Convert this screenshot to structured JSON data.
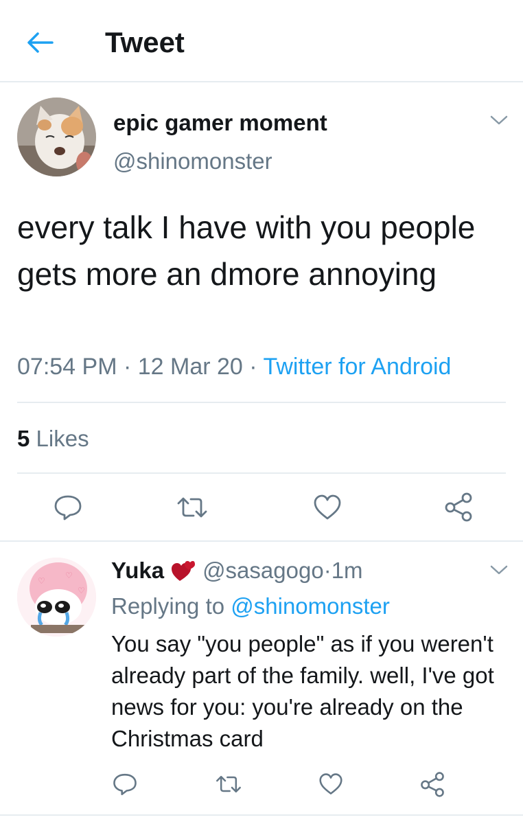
{
  "header": {
    "title": "Tweet"
  },
  "tweet": {
    "display_name": "epic gamer moment",
    "handle": "@shinomonster",
    "text": "every talk I have with you people gets more an dmore annoying",
    "time": "07:54 PM",
    "date": "12 Mar 20",
    "source": "Twitter for Android",
    "separator": " · ",
    "likes_count": "5",
    "likes_label": "Likes"
  },
  "reply": {
    "display_name": "Yuka",
    "emoji": "💕",
    "handle": "@sasagogo",
    "time": "1m",
    "separator": " · ",
    "replying_prefix": "Replying to ",
    "replying_to": "@shinomonster",
    "text": "You say \"you people\" as if you weren't already part of the family. well, I've got news for you: you're already on the Christmas card"
  },
  "icons": {
    "back": "arrow-left-icon",
    "caret": "chevron-down-icon",
    "reply": "comment-icon",
    "retweet": "retweet-icon",
    "like": "heart-icon",
    "share": "share-icon"
  },
  "colors": {
    "accent": "#1da1f2",
    "secondary_text": "#657786",
    "divider": "#e6ecf0",
    "icon": "#657786"
  }
}
